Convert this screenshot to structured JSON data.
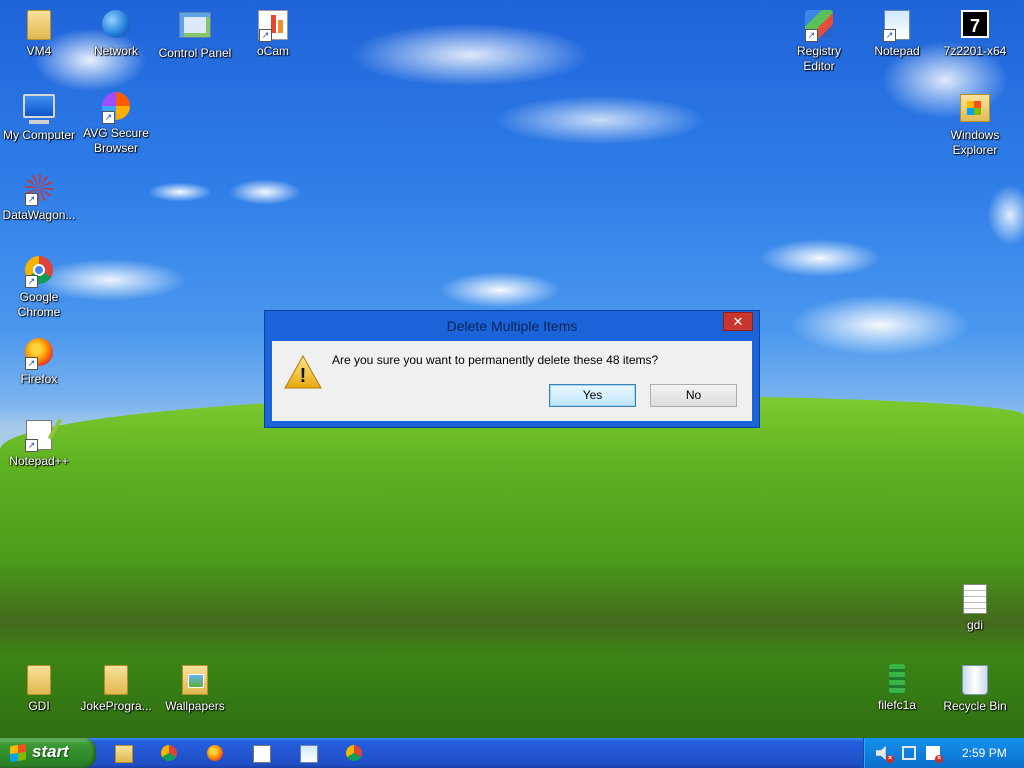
{
  "desktop": {
    "icons_left": [
      {
        "id": "vm4",
        "label": "VM4",
        "icon": "folder-icon"
      },
      {
        "id": "network",
        "label": "Network",
        "icon": "network-icon"
      },
      {
        "id": "control-panel",
        "label": "Control Panel",
        "icon": "control-panel-icon"
      },
      {
        "id": "ocam",
        "label": "oCam",
        "icon": "ocam-icon"
      },
      {
        "id": "my-computer",
        "label": "My Computer",
        "icon": "computer-icon"
      },
      {
        "id": "avg",
        "label": "AVG Secure\nBrowser",
        "icon": "avg-browser-icon"
      },
      {
        "id": "datawagon",
        "label": "DataWagon...",
        "icon": "datawagon-icon"
      },
      {
        "id": "chrome",
        "label": "Google\nChrome",
        "icon": "chrome-icon"
      },
      {
        "id": "firefox",
        "label": "Firefox",
        "icon": "firefox-icon"
      },
      {
        "id": "notepadpp",
        "label": "Notepad++",
        "icon": "notepadpp-icon"
      }
    ],
    "icons_right": [
      {
        "id": "registry",
        "label": "Registry\nEditor",
        "icon": "registry-editor-icon"
      },
      {
        "id": "notepad",
        "label": "Notepad",
        "icon": "notepad-icon"
      },
      {
        "id": "7zip",
        "label": "7z2201-x64",
        "icon": "7zip-icon"
      },
      {
        "id": "windows-explorer",
        "label": "Windows\nExplorer",
        "icon": "windows-explorer-icon"
      },
      {
        "id": "gdi-file",
        "label": "gdi",
        "icon": "document-icon"
      }
    ],
    "icons_bottom": [
      {
        "id": "gdi",
        "label": "GDI",
        "icon": "folder-icon"
      },
      {
        "id": "jokeprogra",
        "label": "JokeProgra...",
        "icon": "folder-icon"
      },
      {
        "id": "wallpapers",
        "label": "Wallpapers",
        "icon": "folder-icon"
      },
      {
        "id": "filefc1a",
        "label": "filefc1a",
        "icon": "executable-icon"
      },
      {
        "id": "recycle-bin",
        "label": "Recycle Bin",
        "icon": "recycle-bin-icon"
      }
    ]
  },
  "dialog": {
    "title": "Delete Multiple Items",
    "close_label": "✕",
    "warning_glyph": "!",
    "message": "Are you sure you want to permanently delete these 48 items?",
    "yes_label": "Yes",
    "no_label": "No"
  },
  "taskbar": {
    "start_label": "start",
    "quicklaunch": [
      "explorer-icon",
      "chrome-icon",
      "firefox-icon",
      "notepadpp-icon",
      "notepad-icon",
      "chrome-icon"
    ],
    "clock": "2:59 PM",
    "tray_icons": [
      "volume-muted-icon",
      "network-disconnected-icon",
      "action-center-icon"
    ]
  },
  "colors": {
    "taskbar_blue": "#245edb",
    "start_green": "#3c9a36",
    "dialog_frame": "#1a63d8",
    "close_red": "#c9372c"
  }
}
